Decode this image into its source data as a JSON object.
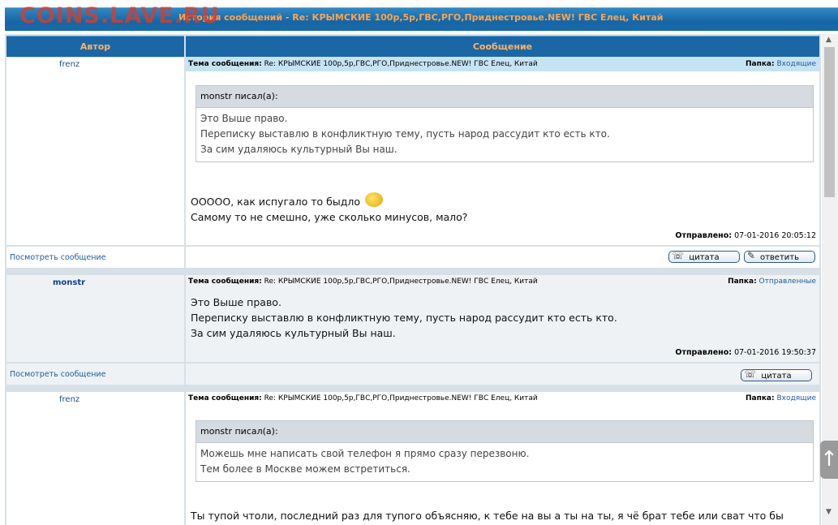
{
  "watermark": "COINS.LAVE.RU",
  "window_title": "История сообщений - Re: КРЫМСКИЕ 100р,5р,ГВС,РГО,Приднестровье.NEW! ГВС Елец, Китай",
  "headers": {
    "author": "Автор",
    "message": "Сообщение"
  },
  "labels": {
    "subject": "Тема сообщения:",
    "folder": "Папка:",
    "sent": "Отправлено:",
    "view_message": "Посмотреть сообщение",
    "quote_button": "цитата",
    "reply_button": "ответить"
  },
  "posts": [
    {
      "author": "frenz",
      "subject": "Re: КРЫМСКИЕ 100р,5р,ГВС,РГО,Приднестровье.NEW! ГВС Елец, Китай",
      "folder": "Входящие",
      "quote_header": "monstr писал(а):",
      "quote_lines": [
        "Это Выше право.",
        "Переписку выставлю в конфликтную тему, пусть народ рассудит кто есть кто.",
        "За сим удаляюсь культурный Вы наш."
      ],
      "body_lines": [
        "ООООО, как испугало то быдло",
        "Самому то не смешно, уже сколько минусов, мало?"
      ],
      "sent": "07-01-2016 20:05:12"
    },
    {
      "author": "monstr",
      "subject": "Re: КРЫМСКИЕ 100р,5р,ГВС,РГО,Приднестровье.NEW! ГВС Елец, Китай",
      "folder": "Отправленные",
      "body_lines": [
        "Это Выше право.",
        "Переписку выставлю в конфликтную тему, пусть народ рассудит кто есть кто.",
        "За сим удаляюсь культурный Вы наш."
      ],
      "sent": "07-01-2016 19:50:37"
    },
    {
      "author": "frenz",
      "subject": "Re: КРЫМСКИЕ 100р,5р,ГВС,РГО,Приднестровье.NEW! ГВС Елец, Китай",
      "folder": "Входящие",
      "quote_header": "monstr писал(а):",
      "quote_lines": [
        "Можешь мне написать свой телефон я прямо сразу перезвоню.",
        "Тем более в Москве можем встретиться."
      ],
      "body_lines": [
        "Ты тупой чтоли, последний раз для тупого объясняю, к тебе на вы а ты на ты, я чё брат тебе или сват что бы"
      ]
    }
  ]
}
